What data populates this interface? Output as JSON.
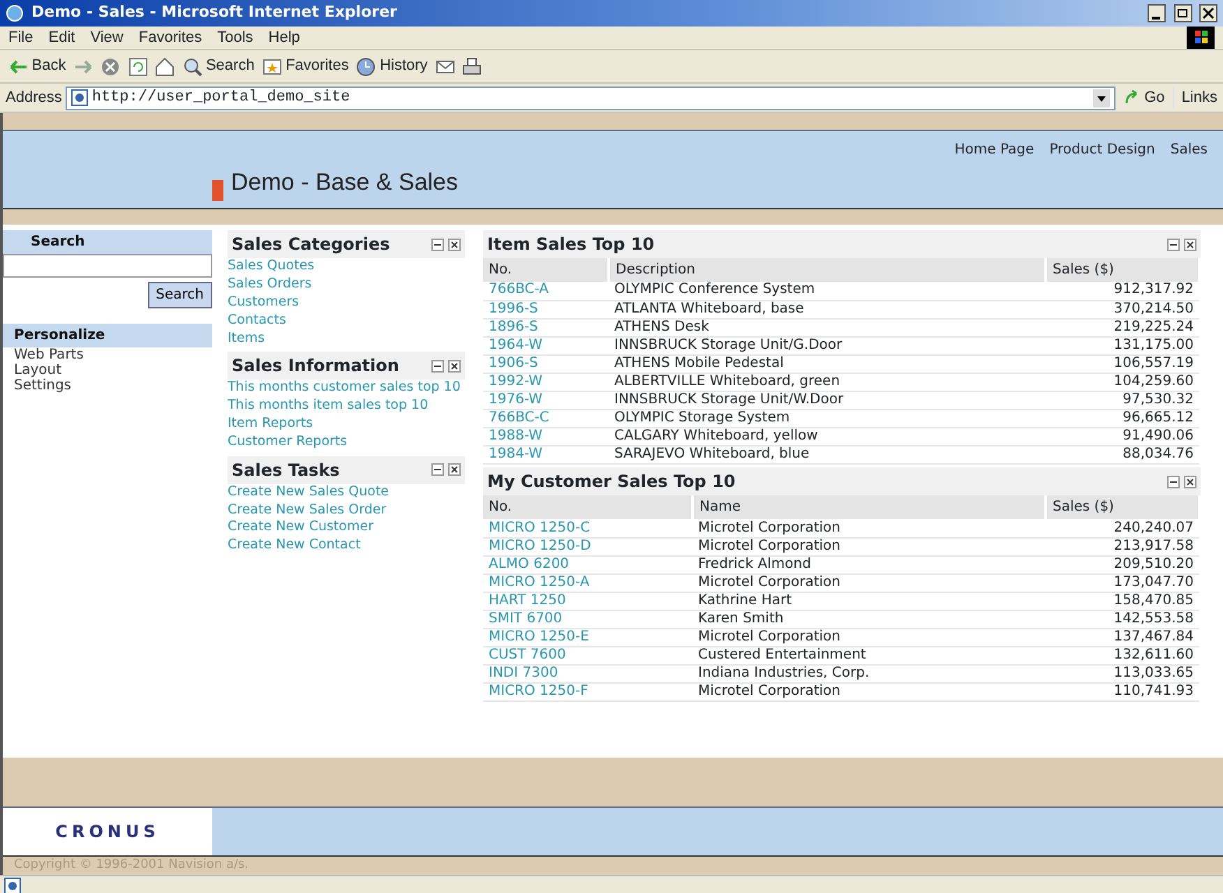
{
  "window": {
    "title": "Demo - Sales - Microsoft Internet Explorer"
  },
  "menu": [
    "File",
    "Edit",
    "View",
    "Favorites",
    "Tools",
    "Help"
  ],
  "toolbar": [
    {
      "kind": "back",
      "label": "Back"
    },
    {
      "kind": "forward"
    },
    {
      "kind": "stop"
    },
    {
      "kind": "refresh"
    },
    {
      "kind": "home"
    },
    {
      "kind": "search",
      "label": "Search"
    },
    {
      "kind": "favorites",
      "label": "Favorites"
    },
    {
      "kind": "history",
      "label": "History"
    },
    {
      "kind": "mail"
    },
    {
      "kind": "print"
    }
  ],
  "address": {
    "label": "Address",
    "value": "http://user_portal_demo_site",
    "go": "Go",
    "links": "Links"
  },
  "header": {
    "title": "Demo - Base & Sales",
    "nav": [
      "Home Page",
      "Product Design",
      "Sales"
    ]
  },
  "sidebar": {
    "search_title": "Search",
    "search_button": "Search",
    "personalize_title": "Personalize",
    "items": [
      "Web Parts",
      "Layout",
      "Settings"
    ]
  },
  "link_groups": [
    {
      "title": "Sales Categories",
      "links": [
        "Sales Quotes",
        "Sales Orders",
        "Customers",
        "Contacts",
        "Items"
      ]
    },
    {
      "title": "Sales Information",
      "links": [
        "This months customer sales top 10",
        "This months item sales top 10",
        "Item Reports",
        "Customer Reports"
      ]
    },
    {
      "title": "Sales Tasks",
      "links": [
        "Create New Sales Quote",
        "Create New Sales Order",
        "Create New Customer",
        "Create New Contact"
      ]
    }
  ],
  "tables": [
    {
      "title": "Item Sales Top 10",
      "columns": [
        "No.",
        "Description",
        "Sales ($)"
      ],
      "rows": [
        [
          "766BC-A",
          "OLYMPIC Conference System",
          "912,317.92"
        ],
        [
          "1996-S",
          "ATLANTA Whiteboard, base",
          "370,214.50"
        ],
        [
          "1896-S",
          "ATHENS Desk",
          "219,225.24"
        ],
        [
          "1964-W",
          "INNSBRUCK Storage Unit/G.Door",
          "131,175.00"
        ],
        [
          "1906-S",
          "ATHENS Mobile Pedestal",
          "106,557.19"
        ],
        [
          "1992-W",
          "ALBERTVILLE Whiteboard, green",
          "104,259.60"
        ],
        [
          "1976-W",
          "INNSBRUCK Storage Unit/W.Door",
          "97,530.32"
        ],
        [
          "766BC-C",
          "OLYMPIC Storage System",
          "96,665.12"
        ],
        [
          "1988-W",
          "CALGARY Whiteboard, yellow",
          "91,490.06"
        ],
        [
          "1984-W",
          "SARAJEVO Whiteboard, blue",
          "88,034.76"
        ]
      ]
    },
    {
      "title": "My Customer Sales Top 10",
      "columns": [
        "No.",
        "Name",
        "Sales ($)"
      ],
      "rows": [
        [
          "MICRO 1250-C",
          "Microtel Corporation",
          "240,240.07"
        ],
        [
          "MICRO 1250-D",
          "Microtel Corporation",
          "213,917.58"
        ],
        [
          "ALMO 6200",
          "Fredrick Almond",
          "209,510.20"
        ],
        [
          "MICRO 1250-A",
          "Microtel Corporation",
          "173,047.70"
        ],
        [
          "HART 1250",
          "Kathrine Hart",
          "158,470.85"
        ],
        [
          "SMIT 6700",
          "Karen Smith",
          "142,553.58"
        ],
        [
          "MICRO 1250-E",
          "Microtel Corporation",
          "137,467.84"
        ],
        [
          "CUST 7600",
          "Custered Entertainment",
          "132,611.60"
        ],
        [
          "INDI 7300",
          "Indiana Industries, Corp.",
          "113,033.65"
        ],
        [
          "MICRO 1250-F",
          "Microtel Corporation",
          "110,741.93"
        ]
      ]
    }
  ],
  "footer": {
    "logo": "CRONUS",
    "copyright": "Copyright © 1996-2001 Navision a/s."
  }
}
